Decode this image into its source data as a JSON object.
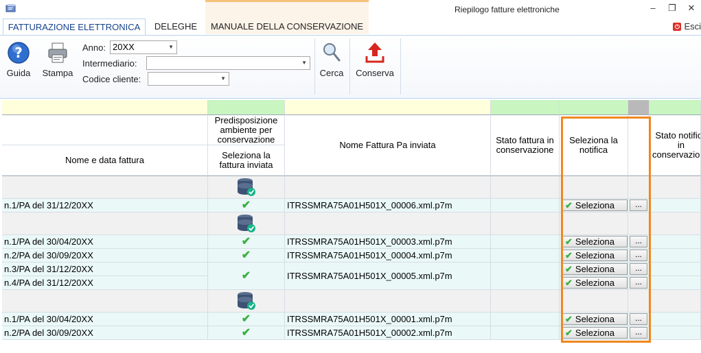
{
  "window": {
    "title": "Riepilogo fatture elettroniche",
    "minimize": "–",
    "restore": "❐",
    "close": "✕"
  },
  "tabs": [
    {
      "label": "FATTURAZIONE ELETTRONICA"
    },
    {
      "label": "DELEGHE"
    },
    {
      "label": "MANUALE DELLA CONSERVAZIONE"
    }
  ],
  "exit_label": "Esci",
  "ribbon": {
    "guida": "Guida",
    "stampa": "Stampa",
    "anno_label": "Anno:",
    "anno_value": "20XX",
    "intermediario_label": "Intermediario:",
    "intermediario_value": "",
    "codice_label": "Codice cliente:",
    "codice_value": "",
    "cerca": "Cerca",
    "conserva": "Conserva"
  },
  "columns": {
    "nome_data": "Nome e data fattura",
    "predisposizione": "Predisposizione ambiente per conservazione",
    "seleziona_fattura": "Seleziona la fattura inviata",
    "nome_pa": "Nome Fattura Pa inviata",
    "stato_fattura": "Stato fattura in conservazione",
    "seleziona_notifica": "Seleziona la notifica",
    "stato_notifica": "Stato notifica in conservazione"
  },
  "select_label": "Seleziona",
  "dots_label": "...",
  "rows": [
    {
      "invoice": "n.1/PA del 31/12/20XX",
      "file": "ITRSSMRA75A01H501X_00006.xml.p7m"
    },
    {
      "invoice": "n.1/PA del 30/04/20XX",
      "file": "ITRSSMRA75A01H501X_00003.xml.p7m"
    },
    {
      "invoice": "n.2/PA del 30/09/20XX",
      "file": "ITRSSMRA75A01H501X_00004.xml.p7m"
    },
    {
      "invoice": "n.3/PA del 31/12/20XX",
      "file": "ITRSSMRA75A01H501X_00005.xml.p7m"
    },
    {
      "invoice": "n.4/PA del 31/12/20XX",
      "file": ""
    },
    {
      "invoice": "n.1/PA del 30/04/20XX",
      "file": "ITRSSMRA75A01H501X_00001.xml.p7m"
    },
    {
      "invoice": "n.2/PA del 30/09/20XX",
      "file": "ITRSSMRA75A01H501X_00002.xml.p7m"
    }
  ],
  "colors": {
    "band_yellow": "#ffffdc",
    "band_green": "#c8f5c0",
    "band_gray": "#b9b9b9",
    "highlight": "#f0871e"
  }
}
